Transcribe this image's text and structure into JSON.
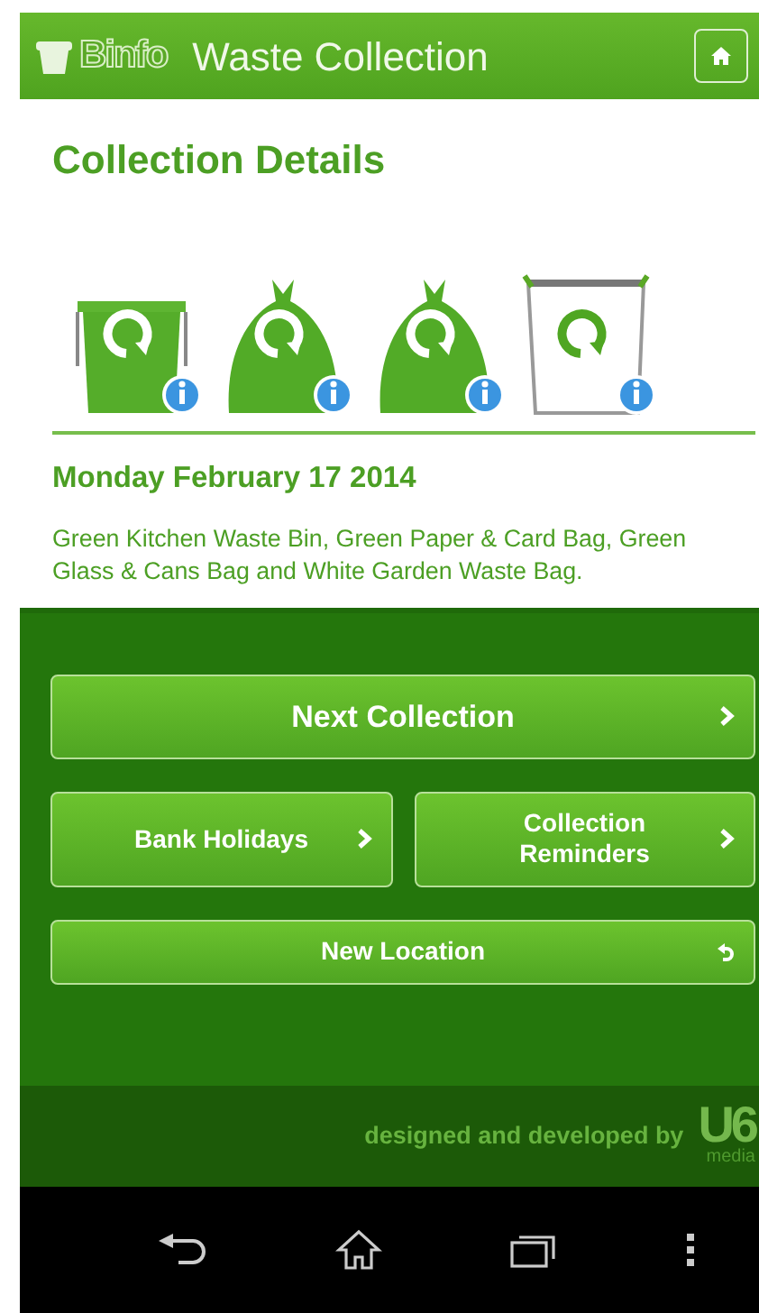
{
  "app_bar": {
    "logo": "Binfo",
    "title": "Waste Collection"
  },
  "heading": "Collection Details",
  "containers": [
    {
      "kind": "bin"
    },
    {
      "kind": "bag"
    },
    {
      "kind": "bag"
    },
    {
      "kind": "sack"
    }
  ],
  "date": "Monday February 17 2014",
  "description": "Green Kitchen Waste Bin, Green Paper & Card Bag, Green Glass & Cans Bag and White Garden Waste Bag.",
  "buttons": [
    {
      "label": "Next Collection",
      "kind": "wide"
    },
    {
      "label": "Bank Holidays",
      "kind": "half"
    },
    {
      "label": "Collection Reminders",
      "kind": "half"
    },
    {
      "label": "New Location",
      "kind": "slim"
    }
  ],
  "footer": {
    "text": "designed and developed by",
    "logo": "U6",
    "logo_sub": "media"
  }
}
